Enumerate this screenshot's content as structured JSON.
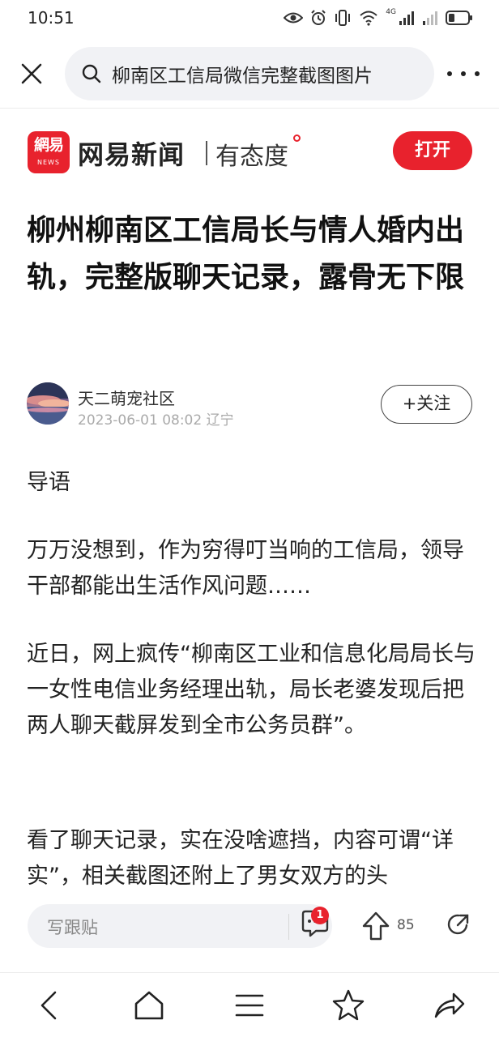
{
  "status_bar": {
    "time": "10:51",
    "network": "4G",
    "icons": [
      "eye-icon",
      "alarm-icon",
      "vibrate-icon",
      "wifi-icon",
      "signal-icon",
      "signal-icon",
      "battery-icon"
    ]
  },
  "browser": {
    "search_query": "柳南区工信局微信完整截图图片",
    "close_icon": "close-icon",
    "more_icon": "more-icon"
  },
  "brand": {
    "logo_cn": "網易",
    "logo_en": "NEWS",
    "name": "网易新闻",
    "slogan": "有态度",
    "open_button": "打开",
    "accent_color": "#e8222d"
  },
  "article": {
    "title": "柳州柳南区工信局长与情人婚内出轨，完整版聊天记录，露骨无下限",
    "author": "天二萌宠社区",
    "publish_time": "2023-06-01 08:02 辽宁",
    "follow_button": "+关注",
    "paragraphs": [
      "导语",
      "万万没想到，作为穷得叮当响的工信局，领导干部都能出生活作风问题……",
      "近日，网上疯传“柳南区工业和信息化局局长与一女性电信业务经理出轨，局长老婆发现后把两人聊天截屏发到全市公务员群”。",
      "看了聊天记录，实在没啥遮挡，内容可谓“详实”，相关截图还附上了男女双方的头"
    ]
  },
  "comment_bar": {
    "placeholder": "写跟贴",
    "comment_count": "1",
    "vote_count": "85"
  },
  "bottom_nav": {
    "items": [
      "back-icon",
      "home-icon",
      "menu-icon",
      "star-icon",
      "share-icon"
    ]
  }
}
